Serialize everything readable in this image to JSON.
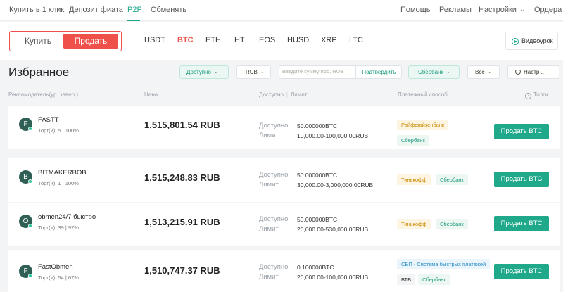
{
  "nav": {
    "left": [
      {
        "label": "Купить в 1 клик",
        "active": false
      },
      {
        "label": "Депозит фиата",
        "active": false
      },
      {
        "label": "P2P",
        "active": true
      },
      {
        "label": "Обменять",
        "active": false
      }
    ],
    "right": [
      {
        "label": "Помощь"
      },
      {
        "label": "Рекламы"
      },
      {
        "label": "Настройки",
        "has_caret": true
      },
      {
        "label": "Ордера"
      }
    ]
  },
  "trade_toggle": {
    "buy": "Купить",
    "sell": "Продать",
    "selected": "sell"
  },
  "coins": [
    "USDT",
    "BTC",
    "ETH",
    "HT",
    "EOS",
    "HUSD",
    "XRP",
    "LTC"
  ],
  "selected_coin": "BTC",
  "video_lesson": {
    "label": "Видеоурок",
    "icon": "play-circle-icon"
  },
  "section_title": "Избранное",
  "filters": {
    "availability": "Доступно",
    "currency": "RUB",
    "amount_placeholder": "Введите сумму про, RUB",
    "confirm": "Подтвердить",
    "payment": "Сбербанк",
    "region": "Все",
    "settings": "Настр..."
  },
  "columns": {
    "advertiser": "Рекламодатель(ур. завер.)",
    "price": "Цена",
    "available": "Доступно",
    "limit": "Лимит",
    "payment": "Платежный способ",
    "trade": "Торги"
  },
  "row_labels": {
    "available": "Доступно",
    "limit": "Лимит"
  },
  "ads": [
    {
      "initial": "F",
      "name": "FASTT",
      "stats": "Торг(и): 5 | 100%",
      "price": "1,515,801.54 RUB",
      "available": "50.000000BTC",
      "limit": "10,000.00-100,000.00RUB",
      "payments": [
        {
          "label": "Райффайзенбанк",
          "color": "yellow"
        },
        {
          "label": "Сбербанк",
          "color": "green"
        }
      ],
      "action": "Продать BTC"
    },
    {
      "initial": "B",
      "name": "BITMAKERBOB",
      "stats": "Торг(и): 1 | 100%",
      "price": "1,515,248.83 RUB",
      "available": "50.000000BTC",
      "limit": "30,000.00-3,000,000.00RUB",
      "payments": [
        {
          "label": "Тинькофф",
          "color": "yellow"
        },
        {
          "label": "Сбербанк",
          "color": "green"
        }
      ],
      "action": "Продать BTC"
    },
    {
      "initial": "O",
      "name": "obmen24/7 быстро",
      "stats": "Торг(и): 39 | 97%",
      "price": "1,513,215.91 RUB",
      "available": "50.000000BTC",
      "limit": "20,000.00-530,000.00RUB",
      "payments": [
        {
          "label": "Тинькофф",
          "color": "yellow"
        },
        {
          "label": "Сбербанк",
          "color": "green"
        }
      ],
      "action": "Продать BTC"
    },
    {
      "initial": "F",
      "name": "FastObmen",
      "stats": "Торг(и): 54 | 67%",
      "price": "1,510,747.37 RUB",
      "available": "0.100000BTC",
      "limit": "20,000.00-100,000.00RUB",
      "payments": [
        {
          "label": "СБП - Система быстрых платежей",
          "color": "blue"
        },
        {
          "label": "ВТБ",
          "color": "gray"
        },
        {
          "label": "Сбербанк",
          "color": "green"
        }
      ],
      "action": "Продать BTC"
    }
  ]
}
